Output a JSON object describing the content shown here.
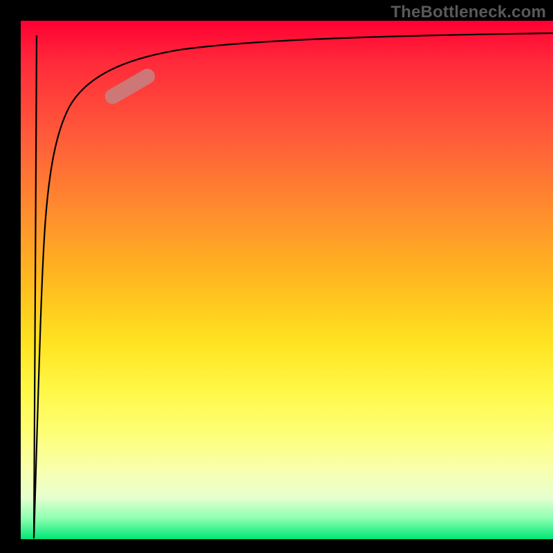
{
  "watermark": "TheBottleneck.com",
  "chart_data": {
    "type": "line",
    "title": "",
    "xlabel": "",
    "ylabel": "",
    "xlim": [
      0,
      100
    ],
    "ylim": [
      0,
      100
    ],
    "grid": false,
    "legend": false,
    "background_gradient": {
      "top": "#ff0033",
      "middle": "#ffe320",
      "bottom": "#00e676"
    },
    "series": [
      {
        "name": "bottleneck-curve",
        "color": "#000000",
        "x": [
          2.5,
          3.0,
          3.4,
          3.8,
          4.2,
          4.8,
          5.5,
          6.5,
          8.0,
          10.0,
          13.0,
          17.0,
          22.0,
          28.0,
          35.0,
          45.0,
          60.0,
          80.0,
          100.0
        ],
        "y": [
          0.0,
          30.0,
          50.0,
          62.0,
          70.0,
          76.0,
          80.0,
          83.5,
          86.5,
          88.8,
          90.5,
          92.0,
          93.2,
          94.1,
          94.8,
          95.5,
          96.1,
          96.6,
          97.0
        ]
      },
      {
        "name": "left-stem",
        "color": "#000000",
        "x": [
          3.0,
          2.5
        ],
        "y": [
          97.0,
          0.0
        ]
      }
    ],
    "marker": {
      "name": "highlight-pill",
      "color": "#c48282",
      "center_x": 20.0,
      "center_y": 87.0,
      "rotation_deg": -30
    }
  }
}
